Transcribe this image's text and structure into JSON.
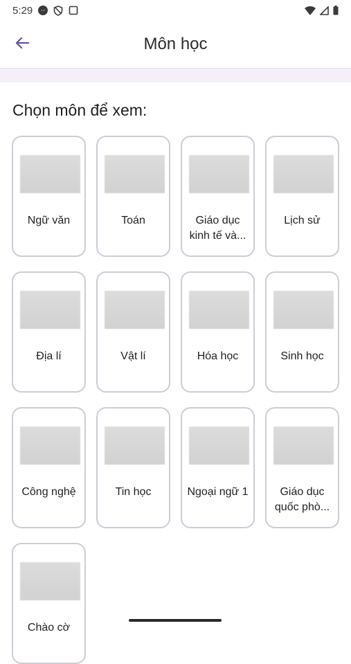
{
  "status_bar": {
    "time": "5:29",
    "icons_left": [
      "messenger-icon",
      "shield-icon",
      "square-icon"
    ],
    "icons_right": [
      "wifi-icon",
      "signal-icon",
      "battery-icon"
    ]
  },
  "app_bar": {
    "title": "Môn học",
    "back_icon": "back-arrow-icon",
    "accent": "#6750a4"
  },
  "section": {
    "title": "Chọn môn để xem:"
  },
  "subjects": [
    {
      "label": "Ngữ văn"
    },
    {
      "label": "Toán"
    },
    {
      "label": "Giáo dục kinh tế và..."
    },
    {
      "label": "Lịch sử"
    },
    {
      "label": "Địa lí"
    },
    {
      "label": "Vật lí"
    },
    {
      "label": "Hóa học"
    },
    {
      "label": "Sinh học"
    },
    {
      "label": "Công nghệ"
    },
    {
      "label": "Tin học"
    },
    {
      "label": "Ngoại ngữ 1"
    },
    {
      "label": "Giáo dục quốc phò..."
    },
    {
      "label": "Chào cờ"
    }
  ]
}
